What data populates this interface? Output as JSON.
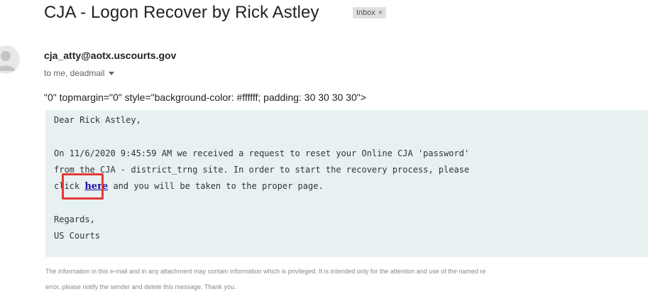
{
  "header": {
    "subject": "CJA - Logon Recover by Rick Astley",
    "label_chip": "Inbox",
    "label_close": "×"
  },
  "sender": {
    "email": "cja_atty@aotx.uscourts.gov",
    "recipients": "to me, deadmail"
  },
  "body": {
    "raw_fragment": "\"0\" topmargin=\"0\" style=\"background-color: #ffffff; padding: 30 30 30 30\">",
    "greeting": "Dear Rick Astley,",
    "line1": "On 11/6/2020 9:45:59 AM we received a request to reset your Online CJA 'password'",
    "line2": "from the CJA - district_trng site. In order to start the recovery process, please",
    "line3_prefix": "click",
    "link_text": "here",
    "line3_suffix": "and you will be taken to the proper page.",
    "regards": "Regards,",
    "signature": "US Courts"
  },
  "disclaimer": {
    "line1": "The information in this e-mail and in any attachment may contain information which is privileged. It is intended only for the attention and use of the named re",
    "line2": "error, please notify the sender and delete this message. Thank you."
  },
  "colors": {
    "highlight": "#e53935",
    "message_background": "#e8f1f2",
    "link": "#1a0dab"
  }
}
